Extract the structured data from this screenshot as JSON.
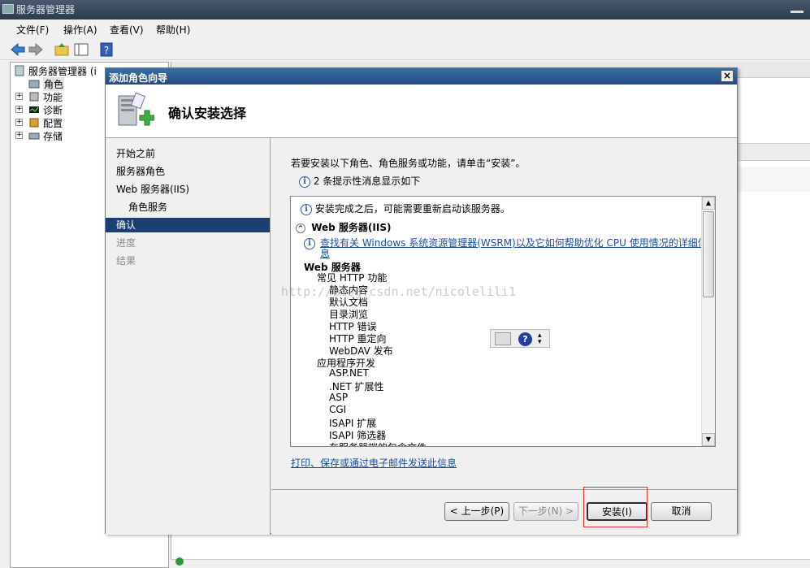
{
  "window": {
    "title": "服务器管理器"
  },
  "menu": [
    "文件(F)",
    "操作(A)",
    "查看(V)",
    "帮助(H)"
  ],
  "tree": {
    "root": "服务器管理器 (i",
    "items": [
      {
        "label": "角色",
        "expandable": false
      },
      {
        "label": "功能",
        "expandable": true
      },
      {
        "label": "诊断",
        "expandable": true
      },
      {
        "label": "配置",
        "expandable": true
      },
      {
        "label": "存储",
        "expandable": true
      }
    ]
  },
  "dialog": {
    "title": "添加角色向导",
    "close": "×",
    "header": "确认安装选择",
    "nav": [
      {
        "label": "开始之前",
        "state": "normal",
        "sub": false
      },
      {
        "label": "服务器角色",
        "state": "normal",
        "sub": false
      },
      {
        "label": "Web 服务器(IIS)",
        "state": "normal",
        "sub": false
      },
      {
        "label": "角色服务",
        "state": "normal",
        "sub": true
      },
      {
        "label": "确认",
        "state": "active",
        "sub": false
      },
      {
        "label": "进度",
        "state": "disabled",
        "sub": false
      },
      {
        "label": "结果",
        "state": "disabled",
        "sub": false
      }
    ],
    "intro": "若要安装以下角色、角色服务或功能，请单击“安装”。",
    "note": "2 条提示性消息显示如下",
    "list": {
      "restart_note": "安装完成之后，可能需要重新启动该服务器。",
      "section": "Web 服务器(IIS)",
      "wsrm_link_1": "查找有关 Windows 系统资源管理器(WSRM)以及它如何帮助优化 CPU 使用情况的详细信",
      "wsrm_link_2": "息",
      "group": "Web 服务器",
      "lines": [
        {
          "text": "常见 HTTP 功能",
          "level": 1
        },
        {
          "text": "静态内容",
          "level": 2
        },
        {
          "text": "默认文档",
          "level": 2
        },
        {
          "text": "目录浏览",
          "level": 2
        },
        {
          "text": "HTTP 错误",
          "level": 2
        },
        {
          "text": "HTTP 重定向",
          "level": 2
        },
        {
          "text": "WebDAV 发布",
          "level": 2
        },
        {
          "text": "应用程序开发",
          "level": 1
        },
        {
          "text": "ASP.NET",
          "level": 2
        },
        {
          "text": ".NET 扩展性",
          "level": 2
        },
        {
          "text": "ASP",
          "level": 2
        },
        {
          "text": "CGI",
          "level": 2
        },
        {
          "text": "ISAPI 扩展",
          "level": 2
        },
        {
          "text": "ISAPI 筛选器",
          "level": 2
        },
        {
          "text": "在服务器端的包含文件",
          "level": 2
        }
      ]
    },
    "watermark": "http://blog.csdn.net/nicolelili1",
    "email_link": "打印、保存或通过电子邮件发送此信息",
    "buttons": {
      "prev": "< 上一步(P)",
      "next": "下一步(N) >",
      "install": "安装(I)",
      "cancel": "取消"
    }
  },
  "colors": {
    "accent": "#1c3f72",
    "highlight_box": "#e53030",
    "link": "#1a4fa0"
  }
}
